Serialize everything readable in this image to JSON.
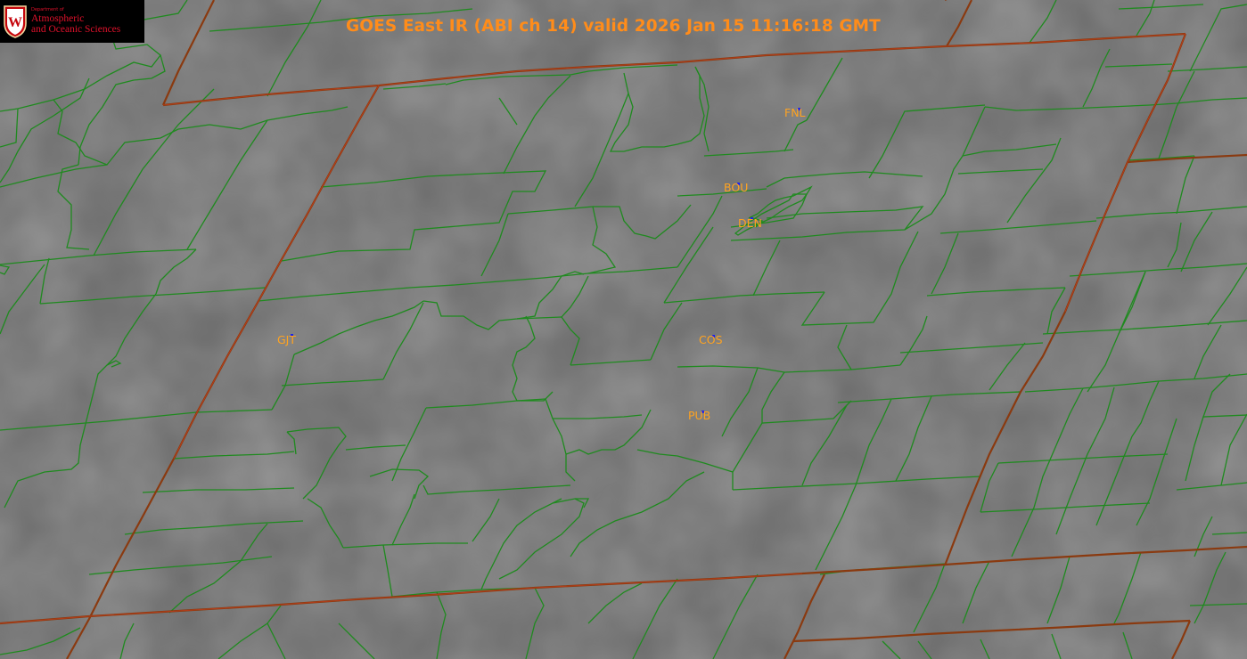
{
  "title": "GOES East IR (ABI ch 14) valid 2026 Jan 15 11:16:18 GMT",
  "logo": {
    "dept_line": "Department of",
    "name_line1": "Atmospheric",
    "name_line2": "and Oceanic Sciences",
    "crest_letter": "W"
  },
  "stations": [
    {
      "id": "fnl",
      "code": "FNL"
    },
    {
      "id": "bou",
      "code": "BOU"
    },
    {
      "id": "den",
      "code": "DEN"
    },
    {
      "id": "gjt",
      "code": "GJT"
    },
    {
      "id": "cos",
      "code": "COS"
    },
    {
      "id": "pub",
      "code": "PUB"
    }
  ],
  "colors": {
    "background_ir": "#6a6a6a",
    "county_lines": "#1f8a1f",
    "state_lines": "#8a3a10",
    "title": "#ff8c1a",
    "station_label": "#ffa320",
    "station_marker": "#1a22ee",
    "logo_text": "#e0112b"
  }
}
